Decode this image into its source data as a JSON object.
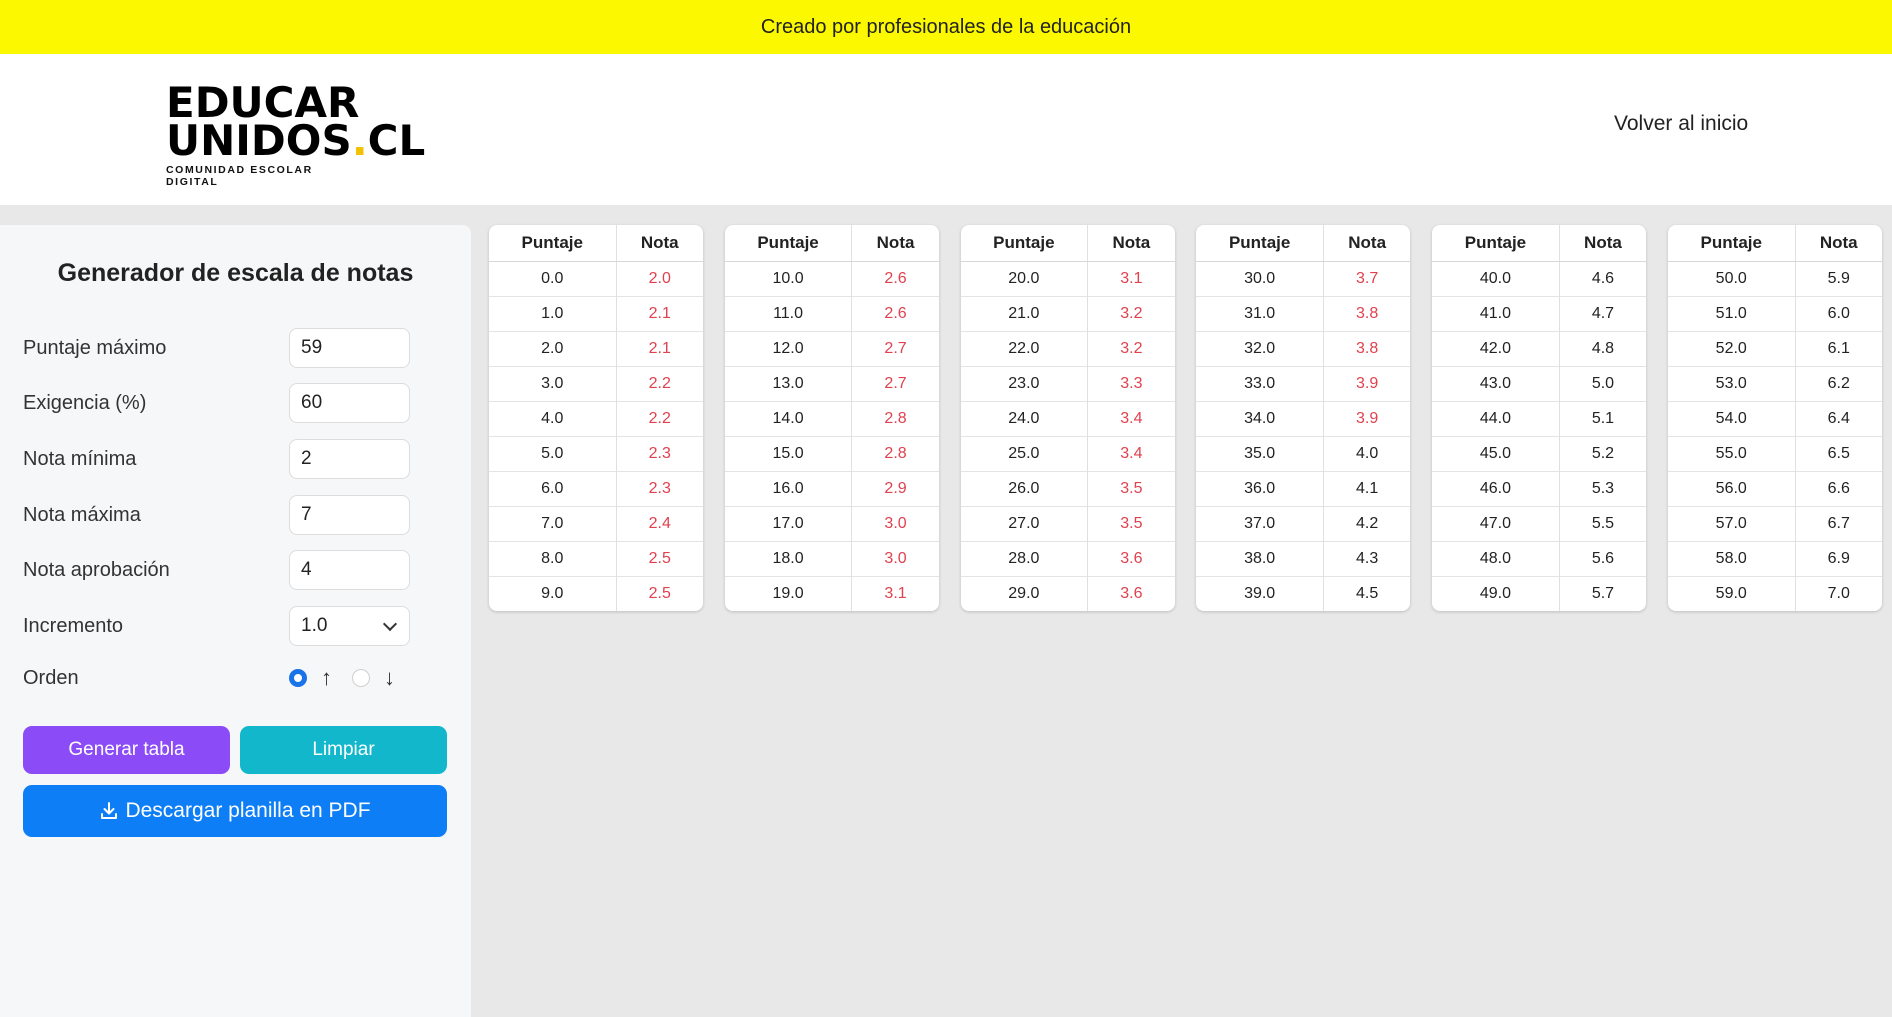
{
  "topbar": {
    "text": "Creado por profesionales de la educación"
  },
  "logo": {
    "line1": "EDUCAR",
    "line2_a": "UNIDOS",
    "line2_dot": ".",
    "line2_b": "CL",
    "tagline": "COMUNIDAD ESCOLAR DIGITAL"
  },
  "nav": {
    "home_link": "Volver al inicio"
  },
  "form": {
    "title": "Generador de escala de notas",
    "max_score": {
      "label": "Puntaje máximo",
      "value": "59"
    },
    "requirement": {
      "label": "Exigencia (%)",
      "value": "60"
    },
    "min_grade": {
      "label": "Nota mínima",
      "value": "2"
    },
    "max_grade": {
      "label": "Nota máxima",
      "value": "7"
    },
    "pass_grade": {
      "label": "Nota aprobación",
      "value": "4"
    },
    "increment": {
      "label": "Incremento",
      "value": "1.0"
    },
    "order": {
      "label": "Orden",
      "asc_symbol": "↑",
      "desc_symbol": "↓",
      "selected": "asc"
    },
    "generate_label": "Generar tabla",
    "clear_label": "Limpiar",
    "pdf_label": "Descargar planilla en PDF"
  },
  "colors": {
    "topbar": "#fbf800",
    "fail_grade": "#e0414e",
    "generate": "#8b4cf7",
    "clear": "#12b7cc",
    "pdf": "#0d7ef5"
  },
  "table": {
    "headers": {
      "score": "Puntaje",
      "grade": "Nota"
    },
    "pass_threshold": 4.0,
    "columns": [
      [
        [
          "0.0",
          "2.0"
        ],
        [
          "1.0",
          "2.1"
        ],
        [
          "2.0",
          "2.1"
        ],
        [
          "3.0",
          "2.2"
        ],
        [
          "4.0",
          "2.2"
        ],
        [
          "5.0",
          "2.3"
        ],
        [
          "6.0",
          "2.3"
        ],
        [
          "7.0",
          "2.4"
        ],
        [
          "8.0",
          "2.5"
        ],
        [
          "9.0",
          "2.5"
        ]
      ],
      [
        [
          "10.0",
          "2.6"
        ],
        [
          "11.0",
          "2.6"
        ],
        [
          "12.0",
          "2.7"
        ],
        [
          "13.0",
          "2.7"
        ],
        [
          "14.0",
          "2.8"
        ],
        [
          "15.0",
          "2.8"
        ],
        [
          "16.0",
          "2.9"
        ],
        [
          "17.0",
          "3.0"
        ],
        [
          "18.0",
          "3.0"
        ],
        [
          "19.0",
          "3.1"
        ]
      ],
      [
        [
          "20.0",
          "3.1"
        ],
        [
          "21.0",
          "3.2"
        ],
        [
          "22.0",
          "3.2"
        ],
        [
          "23.0",
          "3.3"
        ],
        [
          "24.0",
          "3.4"
        ],
        [
          "25.0",
          "3.4"
        ],
        [
          "26.0",
          "3.5"
        ],
        [
          "27.0",
          "3.5"
        ],
        [
          "28.0",
          "3.6"
        ],
        [
          "29.0",
          "3.6"
        ]
      ],
      [
        [
          "30.0",
          "3.7"
        ],
        [
          "31.0",
          "3.8"
        ],
        [
          "32.0",
          "3.8"
        ],
        [
          "33.0",
          "3.9"
        ],
        [
          "34.0",
          "3.9"
        ],
        [
          "35.0",
          "4.0"
        ],
        [
          "36.0",
          "4.1"
        ],
        [
          "37.0",
          "4.2"
        ],
        [
          "38.0",
          "4.3"
        ],
        [
          "39.0",
          "4.5"
        ]
      ],
      [
        [
          "40.0",
          "4.6"
        ],
        [
          "41.0",
          "4.7"
        ],
        [
          "42.0",
          "4.8"
        ],
        [
          "43.0",
          "5.0"
        ],
        [
          "44.0",
          "5.1"
        ],
        [
          "45.0",
          "5.2"
        ],
        [
          "46.0",
          "5.3"
        ],
        [
          "47.0",
          "5.5"
        ],
        [
          "48.0",
          "5.6"
        ],
        [
          "49.0",
          "5.7"
        ]
      ],
      [
        [
          "50.0",
          "5.9"
        ],
        [
          "51.0",
          "6.0"
        ],
        [
          "52.0",
          "6.1"
        ],
        [
          "53.0",
          "6.2"
        ],
        [
          "54.0",
          "6.4"
        ],
        [
          "55.0",
          "6.5"
        ],
        [
          "56.0",
          "6.6"
        ],
        [
          "57.0",
          "6.7"
        ],
        [
          "58.0",
          "6.9"
        ],
        [
          "59.0",
          "7.0"
        ]
      ]
    ]
  }
}
